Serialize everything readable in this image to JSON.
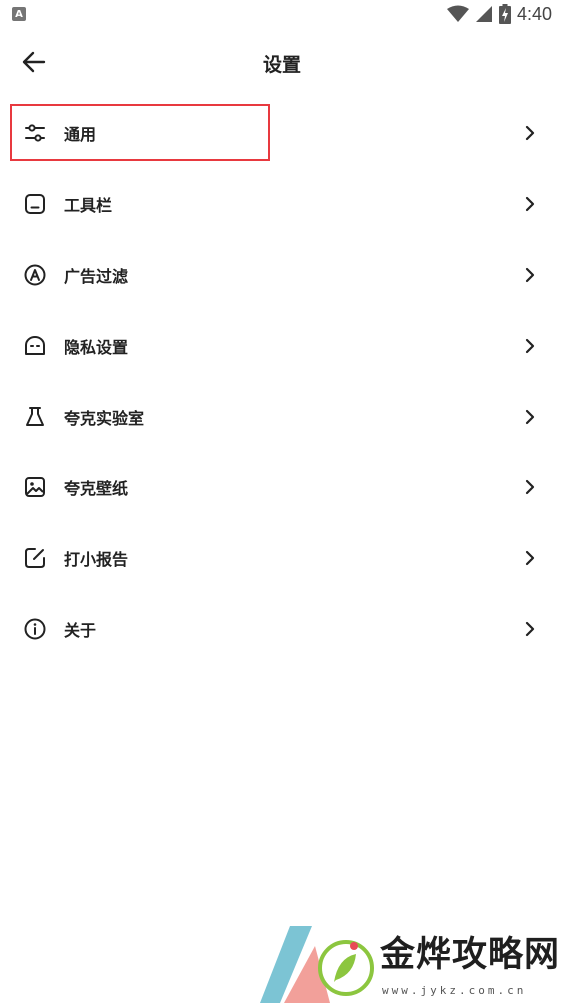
{
  "status_bar": {
    "notification_icon_letter": "A",
    "time": "4:40",
    "icons": [
      "notification-a-icon",
      "wifi-icon",
      "cellular-signal-icon",
      "battery-charging-icon"
    ]
  },
  "app_bar": {
    "back_icon": "arrow-left-icon",
    "title": "设置"
  },
  "menu": {
    "items": [
      {
        "label": "通用",
        "icon": "sliders-icon"
      },
      {
        "label": "工具栏",
        "icon": "toolbar-icon"
      },
      {
        "label": "广告过滤",
        "icon": "ad-block-icon"
      },
      {
        "label": "隐私设置",
        "icon": "privacy-mask-icon"
      },
      {
        "label": "夸克实验室",
        "icon": "flask-icon"
      },
      {
        "label": "夸克壁纸",
        "icon": "wallpaper-image-icon"
      },
      {
        "label": "打小报告",
        "icon": "feedback-edit-icon"
      },
      {
        "label": "关于",
        "icon": "info-icon"
      }
    ],
    "chevron_icon": "chevron-right-icon"
  },
  "watermark": {
    "text": "金烨攻略网",
    "url": "www.jykz.com.cn"
  },
  "colors": {
    "highlight": "#e8393f",
    "text": "#222222",
    "background": "#ffffff"
  }
}
